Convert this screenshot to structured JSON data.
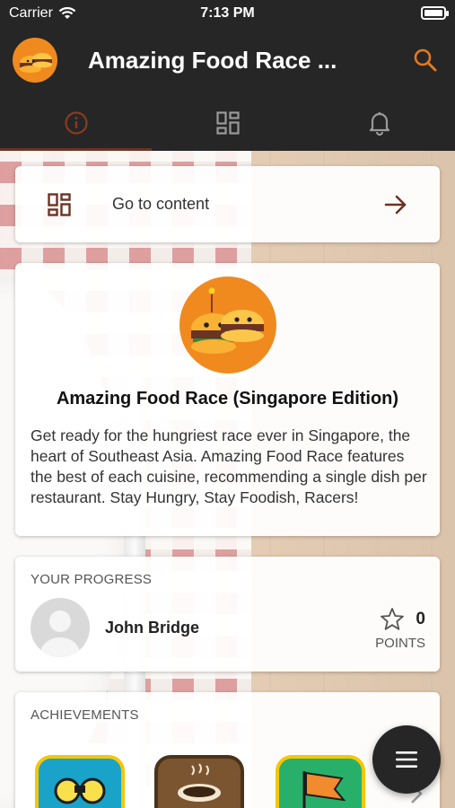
{
  "status_bar": {
    "carrier": "Carrier",
    "time": "7:13 PM"
  },
  "app_bar": {
    "title": "Amazing Food Race ...",
    "search_icon": "search-icon"
  },
  "tabs": [
    {
      "name": "info",
      "icon": "info-icon",
      "active": true
    },
    {
      "name": "content",
      "icon": "grid-icon",
      "active": false
    },
    {
      "name": "notifications",
      "icon": "bell-icon",
      "active": false
    }
  ],
  "go_to_content": {
    "label": "Go to content"
  },
  "info_card": {
    "title": "Amazing Food Race (Singapore Edition)",
    "description": "Get ready for the hungriest race ever in Singapore, the heart of Southeast Asia. Amazing Food Race features the best of each cuisine, recommending a single dish per restaurant. Stay Hungry, Stay Foodish, Racers!"
  },
  "progress": {
    "heading": "YOUR PROGRESS",
    "user_name": "John Bridge",
    "points": "0",
    "points_label": "POINTS"
  },
  "achievements": {
    "heading": "ACHIEVEMENTS"
  },
  "colors": {
    "accent": "#6b3323",
    "brand_orange": "#f08a1e",
    "bar": "#262626"
  }
}
